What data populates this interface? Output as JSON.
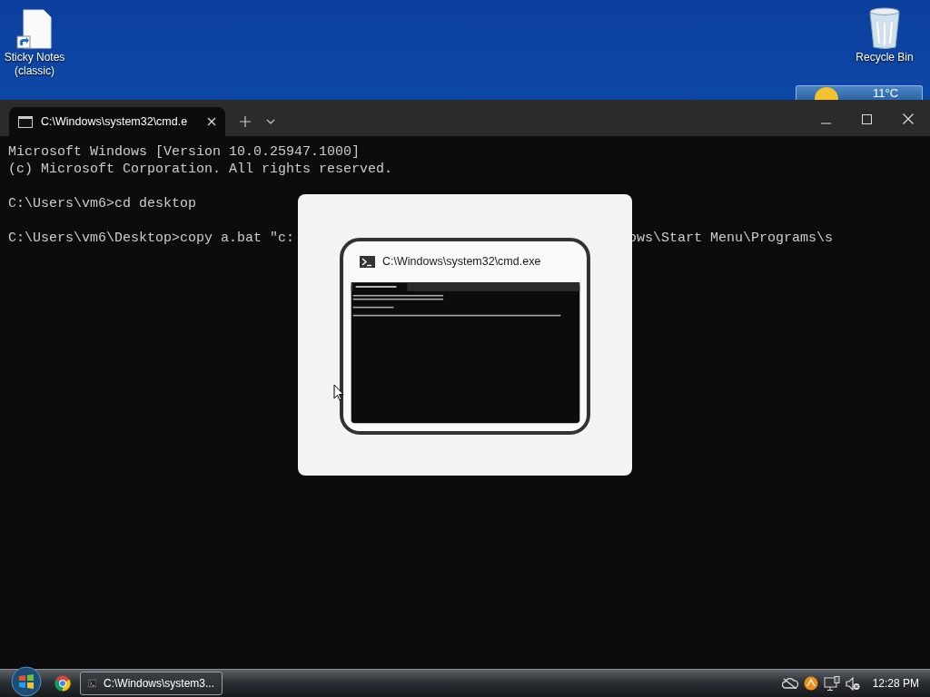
{
  "desktop": {
    "icons": [
      {
        "label": "Sticky Notes (classic)",
        "kind": "note"
      },
      {
        "label": "Recycle Bin",
        "kind": "bin"
      }
    ],
    "weather": {
      "temperature": "11°C"
    }
  },
  "terminal": {
    "tabs": [
      {
        "title": "C:\\Windows\\system32\\cmd.e",
        "selected": true
      }
    ],
    "lines": [
      {
        "kind": "output",
        "segments": [
          "Microsoft Windows [Version 10.0.25947.1000]"
        ]
      },
      {
        "kind": "output",
        "segments": [
          "(c) Microsoft Corporation. All rights reserved."
        ]
      },
      {
        "kind": "command",
        "segments": [
          "C:\\Users\\vm6>cd desktop"
        ]
      },
      {
        "kind": "command",
        "segments": [
          "C:\\Users\\vm6\\Desktop>copy a.bat \"c:",
          "ows\\Start Menu\\Programs\\s"
        ]
      }
    ]
  },
  "switcher": {
    "windows": [
      {
        "title": "C:\\Windows\\system32\\cmd.exe",
        "selected": true
      }
    ]
  },
  "taskbar": {
    "buttons": [
      {
        "label": "C:\\Windows\\system3...",
        "selected": true
      }
    ],
    "clock": "12:28 PM"
  }
}
